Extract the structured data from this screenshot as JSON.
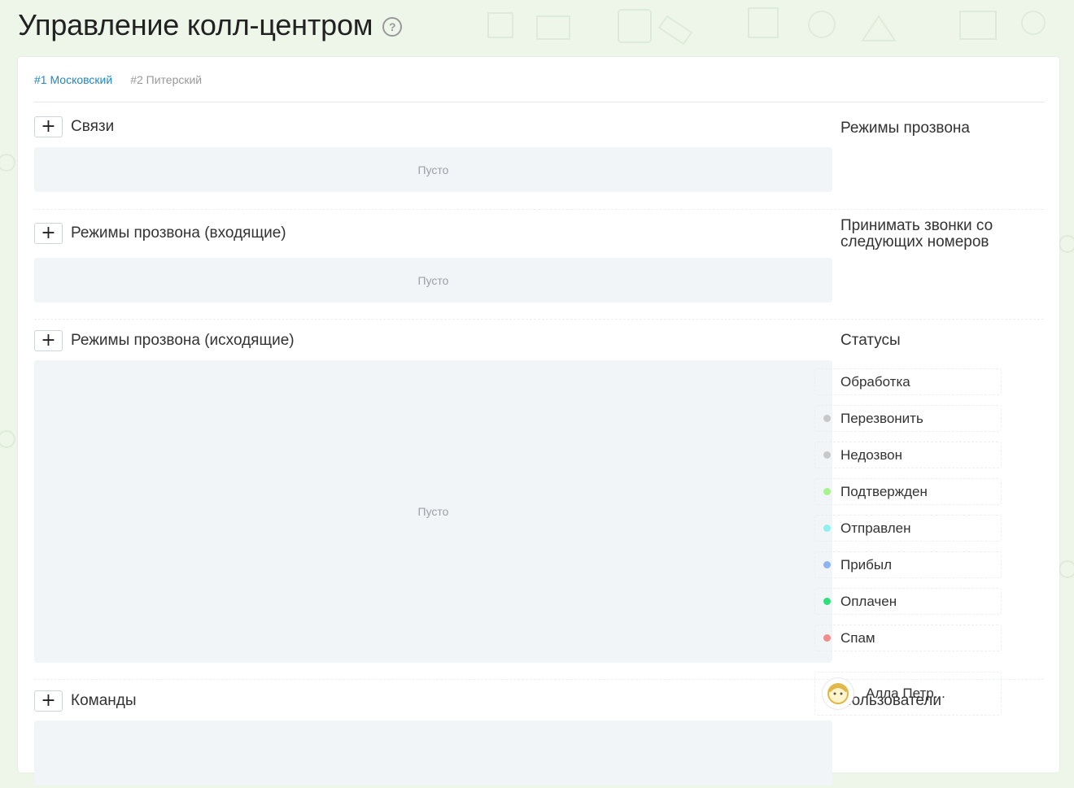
{
  "header": {
    "title": "Управление колл-центром",
    "help_icon": "question-circle-icon"
  },
  "tabs": [
    {
      "label": "#1 Московский",
      "active": true
    },
    {
      "label": "#2 Питерский",
      "active": false
    }
  ],
  "sections": [
    {
      "title": "Связи",
      "empty_label": "Пусто",
      "side_title": "Режимы прозвона"
    },
    {
      "title": "Режимы прозвона (входящие)",
      "empty_label": "Пусто",
      "side_title": "Принимать звонки со следующих номеров"
    },
    {
      "title": "Режимы прозвона (исходящие)",
      "empty_label": "Пусто",
      "side_title": "Статусы"
    },
    {
      "title": "Команды",
      "empty_label": "",
      "side_title": "Пользователи"
    }
  ],
  "add_button_label": "+",
  "statuses": [
    {
      "label": "Обработка",
      "color": ""
    },
    {
      "label": "Перезвонить",
      "color": "#c8c8c8"
    },
    {
      "label": "Недозвон",
      "color": "#c8c8c8"
    },
    {
      "label": "Подтвержден",
      "color": "#a6f28c"
    },
    {
      "label": "Отправлен",
      "color": "#8ff0f0"
    },
    {
      "label": "Прибыл",
      "color": "#8db4f0"
    },
    {
      "label": "Оплачен",
      "color": "#2ee07a"
    },
    {
      "label": "Спам",
      "color": "#f08c8c"
    }
  ],
  "users": [
    {
      "name": "Алла Петр...",
      "avatar": "avatar-icon"
    }
  ],
  "colors": {
    "accent": "#1e88c7",
    "background": "#eef6ea",
    "empty_box": "#f1f5f7"
  }
}
